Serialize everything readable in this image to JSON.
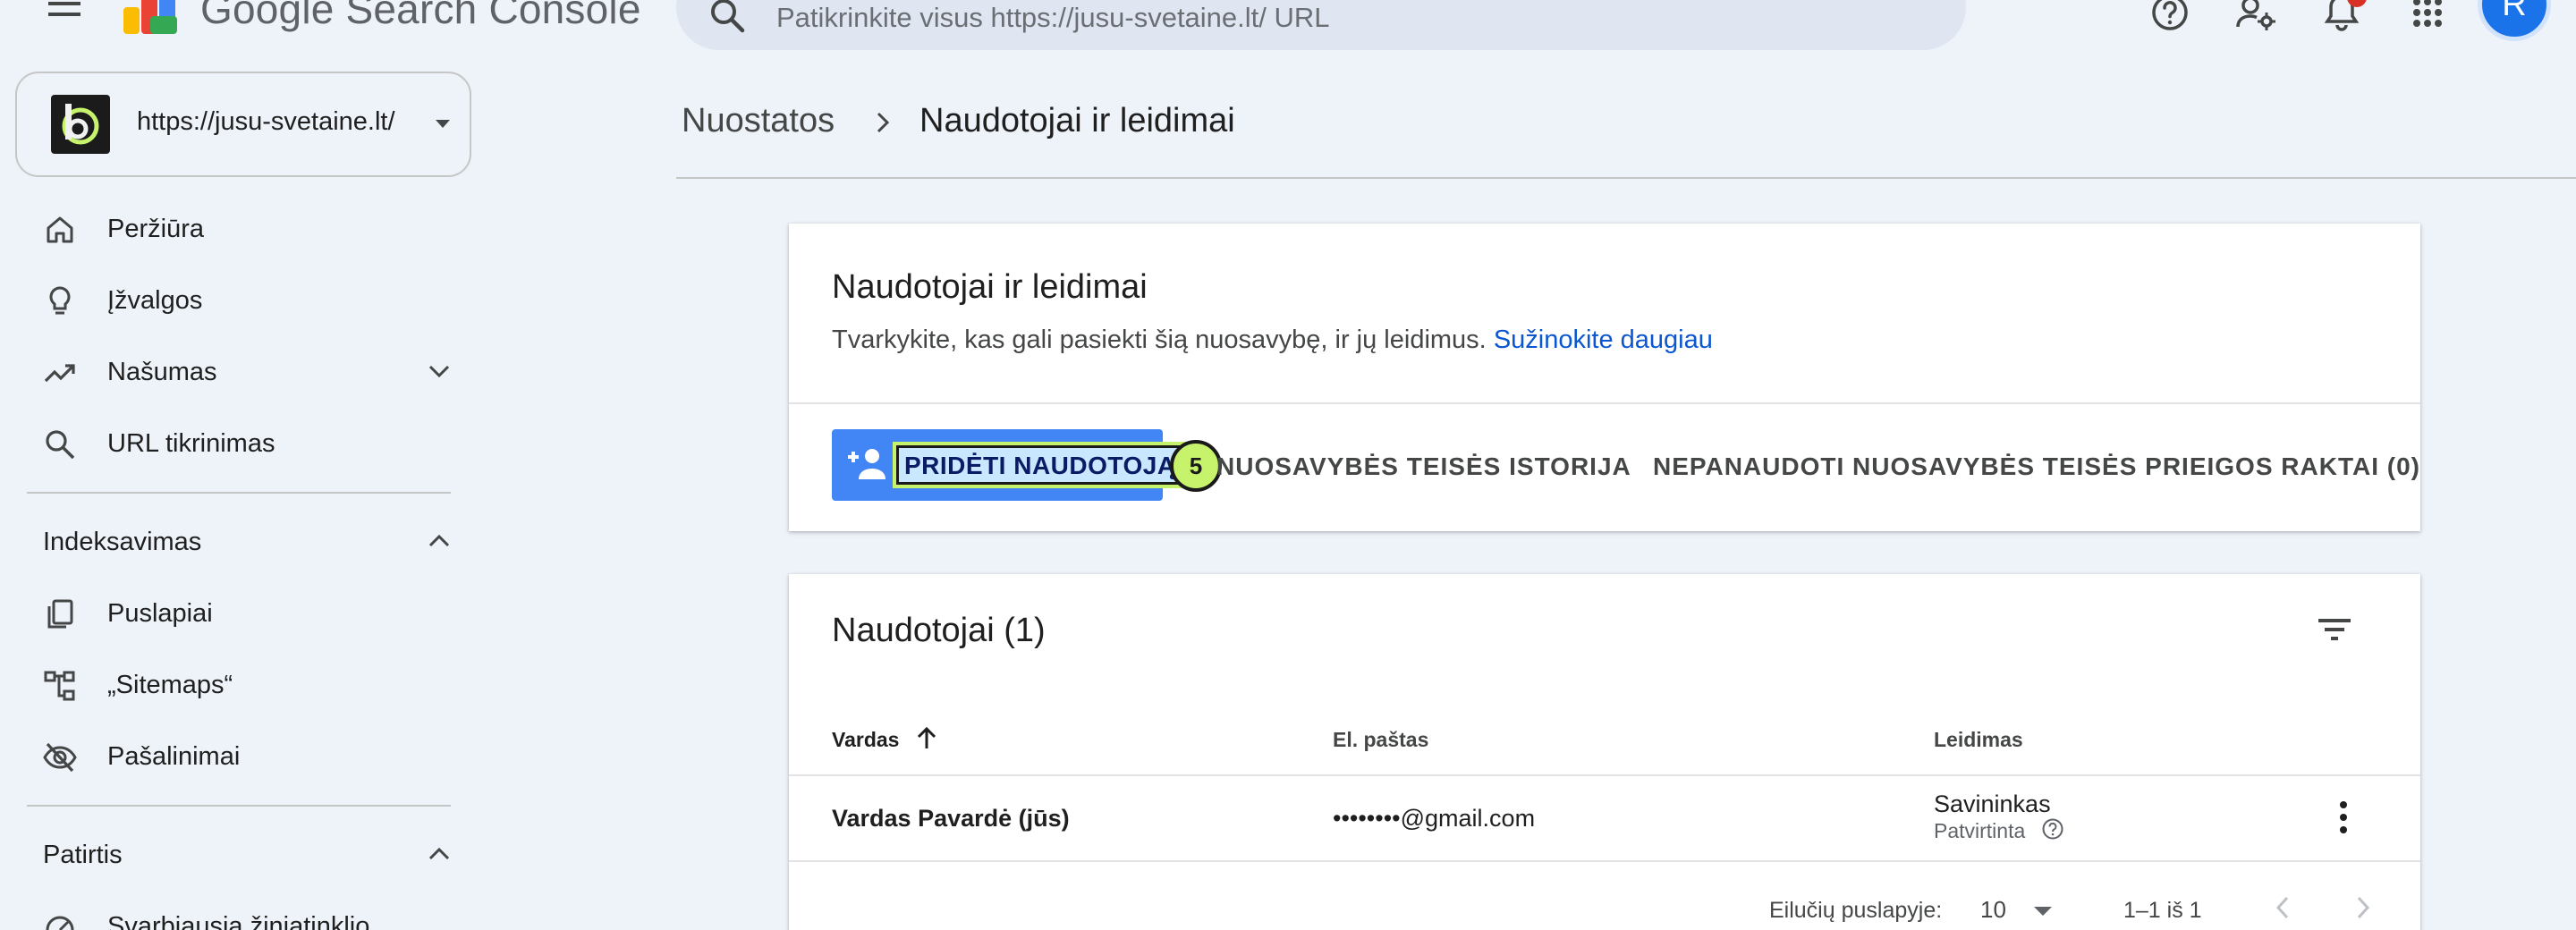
{
  "header": {
    "app_title": "Google Search Console",
    "search_placeholder": "Patikrinkite visus https://jusu-svetaine.lt/ URL",
    "avatar_initial": "R",
    "icons": [
      "menu-icon",
      "help-icon",
      "manage-users-icon",
      "notifications-icon",
      "apps-icon"
    ]
  },
  "sidebar": {
    "property": "https://jusu-svetaine.lt/",
    "items": [
      {
        "label": "Peržiūra",
        "icon": "home-icon"
      },
      {
        "label": "Įžvalgos",
        "icon": "lightbulb-icon"
      },
      {
        "label": "Našumas",
        "icon": "trending-up-icon"
      },
      {
        "label": "URL tikrinimas",
        "icon": "search-icon"
      }
    ],
    "sections": [
      {
        "label": "Indeksavimas",
        "items": [
          {
            "label": "Puslapiai",
            "icon": "pages-icon"
          },
          {
            "label": "„Sitemaps“",
            "icon": "sitemap-icon"
          },
          {
            "label": "Pašalinimai",
            "icon": "visibility-off-icon"
          }
        ]
      },
      {
        "label": "Patirtis",
        "items": [
          {
            "label": "Svarbiausia žiniatinklio",
            "icon": "gauge-icon"
          }
        ]
      }
    ]
  },
  "breadcrumb": {
    "parent": "Nuostatos",
    "current": "Naudotojai ir leidimai"
  },
  "permissions_card": {
    "title": "Naudotojai ir leidimai",
    "description": "Tvarkykite, kas gali pasiekti šią nuosavybę, ir jų leidimus.",
    "learn_more": "Sužinokite daugiau",
    "add_user_label": "PRIDĖTI NAUDOTOJĄ",
    "step_badge": "5",
    "tabs": [
      "NUOSAVYBĖS TEISĖS ISTORIJA",
      "NEPANAUDOTI NUOSAVYBĖS TEISĖS PRIEIGOS RAKTAI (0)"
    ]
  },
  "users_card": {
    "title": "Naudotojai (1)",
    "columns": [
      "Vardas",
      "El. paštas",
      "Leidimas"
    ],
    "rows": [
      {
        "name": "Vardas Pavardė (jūs)",
        "email": "••••••••@gmail.com",
        "permission": "Savininkas",
        "status": "Patvirtinta"
      }
    ],
    "pagination": {
      "rows_per_page_label": "Eilučių puslapyje:",
      "rows_per_page": "10",
      "range": "1–1 iš 1"
    }
  },
  "colors": {
    "accent": "#4285f4",
    "link": "#0b57d0",
    "highlight": "#c6f36b",
    "background": "#eef2f9"
  }
}
